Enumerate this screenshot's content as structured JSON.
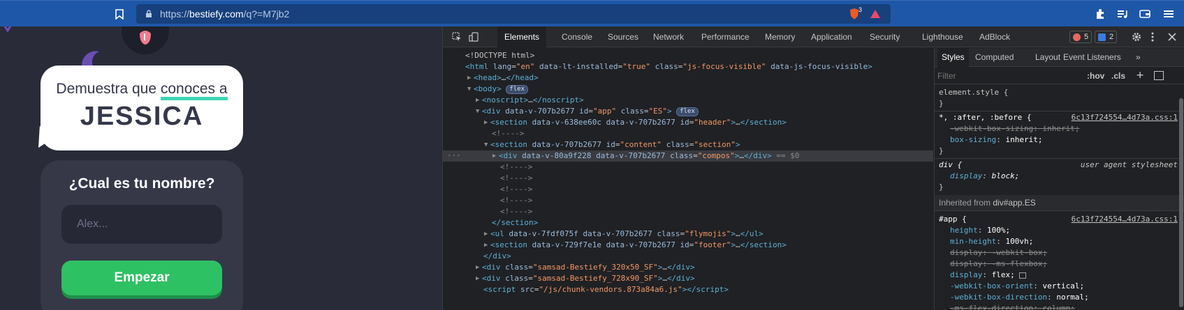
{
  "browser": {
    "url_prefix": "https://",
    "url_host": "bestiefy.com",
    "url_path": "/q?=M7jb2",
    "brave_badge": "3"
  },
  "site": {
    "heading_part1": "Demuestra que ",
    "heading_highlight": "conoces a",
    "heading_name": "JESSICA",
    "card_title": "¿Cual es tu nombre?",
    "name_placeholder": "Alex...",
    "start_button": "Empezar"
  },
  "devtools": {
    "tabs": [
      "Elements",
      "Console",
      "Sources",
      "Network",
      "Performance",
      "Memory",
      "Application",
      "Security",
      "Lighthouse",
      "AdBlock"
    ],
    "errors_count": "5",
    "messages_count": "2",
    "elements": {
      "doctype": "<!DOCTYPE html>",
      "flex_badge": "flex",
      "comment": "<!---->",
      "selected_marker": "== $0",
      "ellipsis": "…"
    },
    "styles": {
      "tabs": [
        "Styles",
        "Computed",
        "Layout",
        "Event Listeners"
      ],
      "filter_placeholder": "Filter",
      "hov": ":hov",
      "cls": ".cls",
      "element_style": "element.style {",
      "close_brace": "}",
      "rule1_selector": "*, :after, :before {",
      "rule1_source": "6c13f724554…4d73a.css:1",
      "rule2_selector": "div {",
      "rule2_source": "user agent stylesheet",
      "inherited_label": "Inherited from ",
      "inherited_from": "div#app.ES",
      "rule3_selector": "#app {",
      "rule3_source": "6c13f724554…4d73a.css:1"
    }
  }
}
